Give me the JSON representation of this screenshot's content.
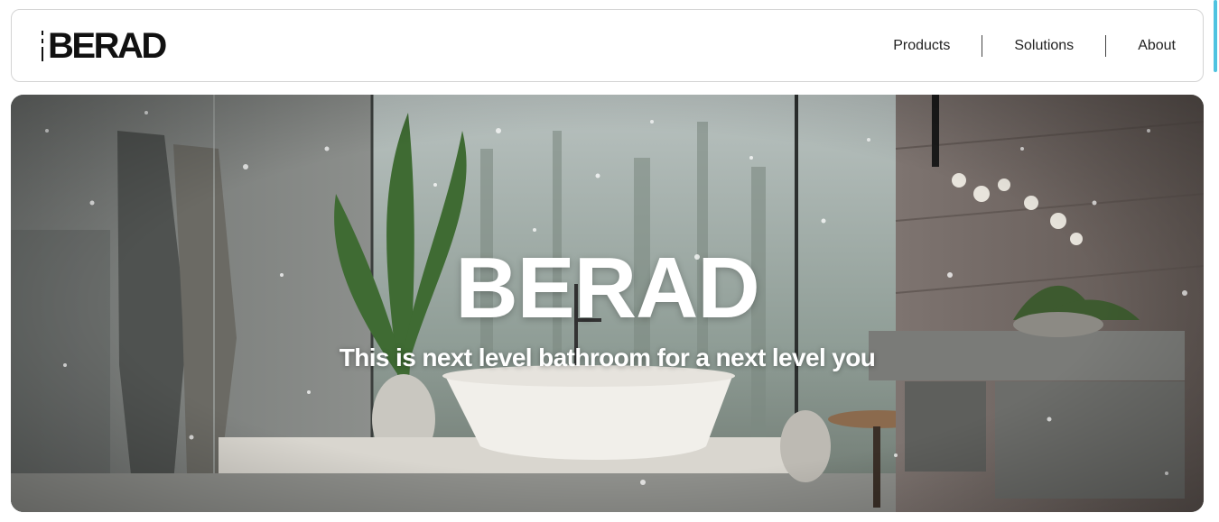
{
  "header": {
    "logo_text": "BERAD",
    "nav": [
      {
        "label": "Products"
      },
      {
        "label": "Solutions"
      },
      {
        "label": "About"
      }
    ]
  },
  "hero": {
    "title": "BERAD",
    "subtitle": "This is next level bathroom for a next level you",
    "image_description": "bathroom-with-freestanding-tub-forest-view"
  },
  "colors": {
    "text_dark": "#111111",
    "border": "#d4d4d4",
    "scrollbar_accent": "#4fc3e0",
    "hero_text": "#ffffff"
  }
}
